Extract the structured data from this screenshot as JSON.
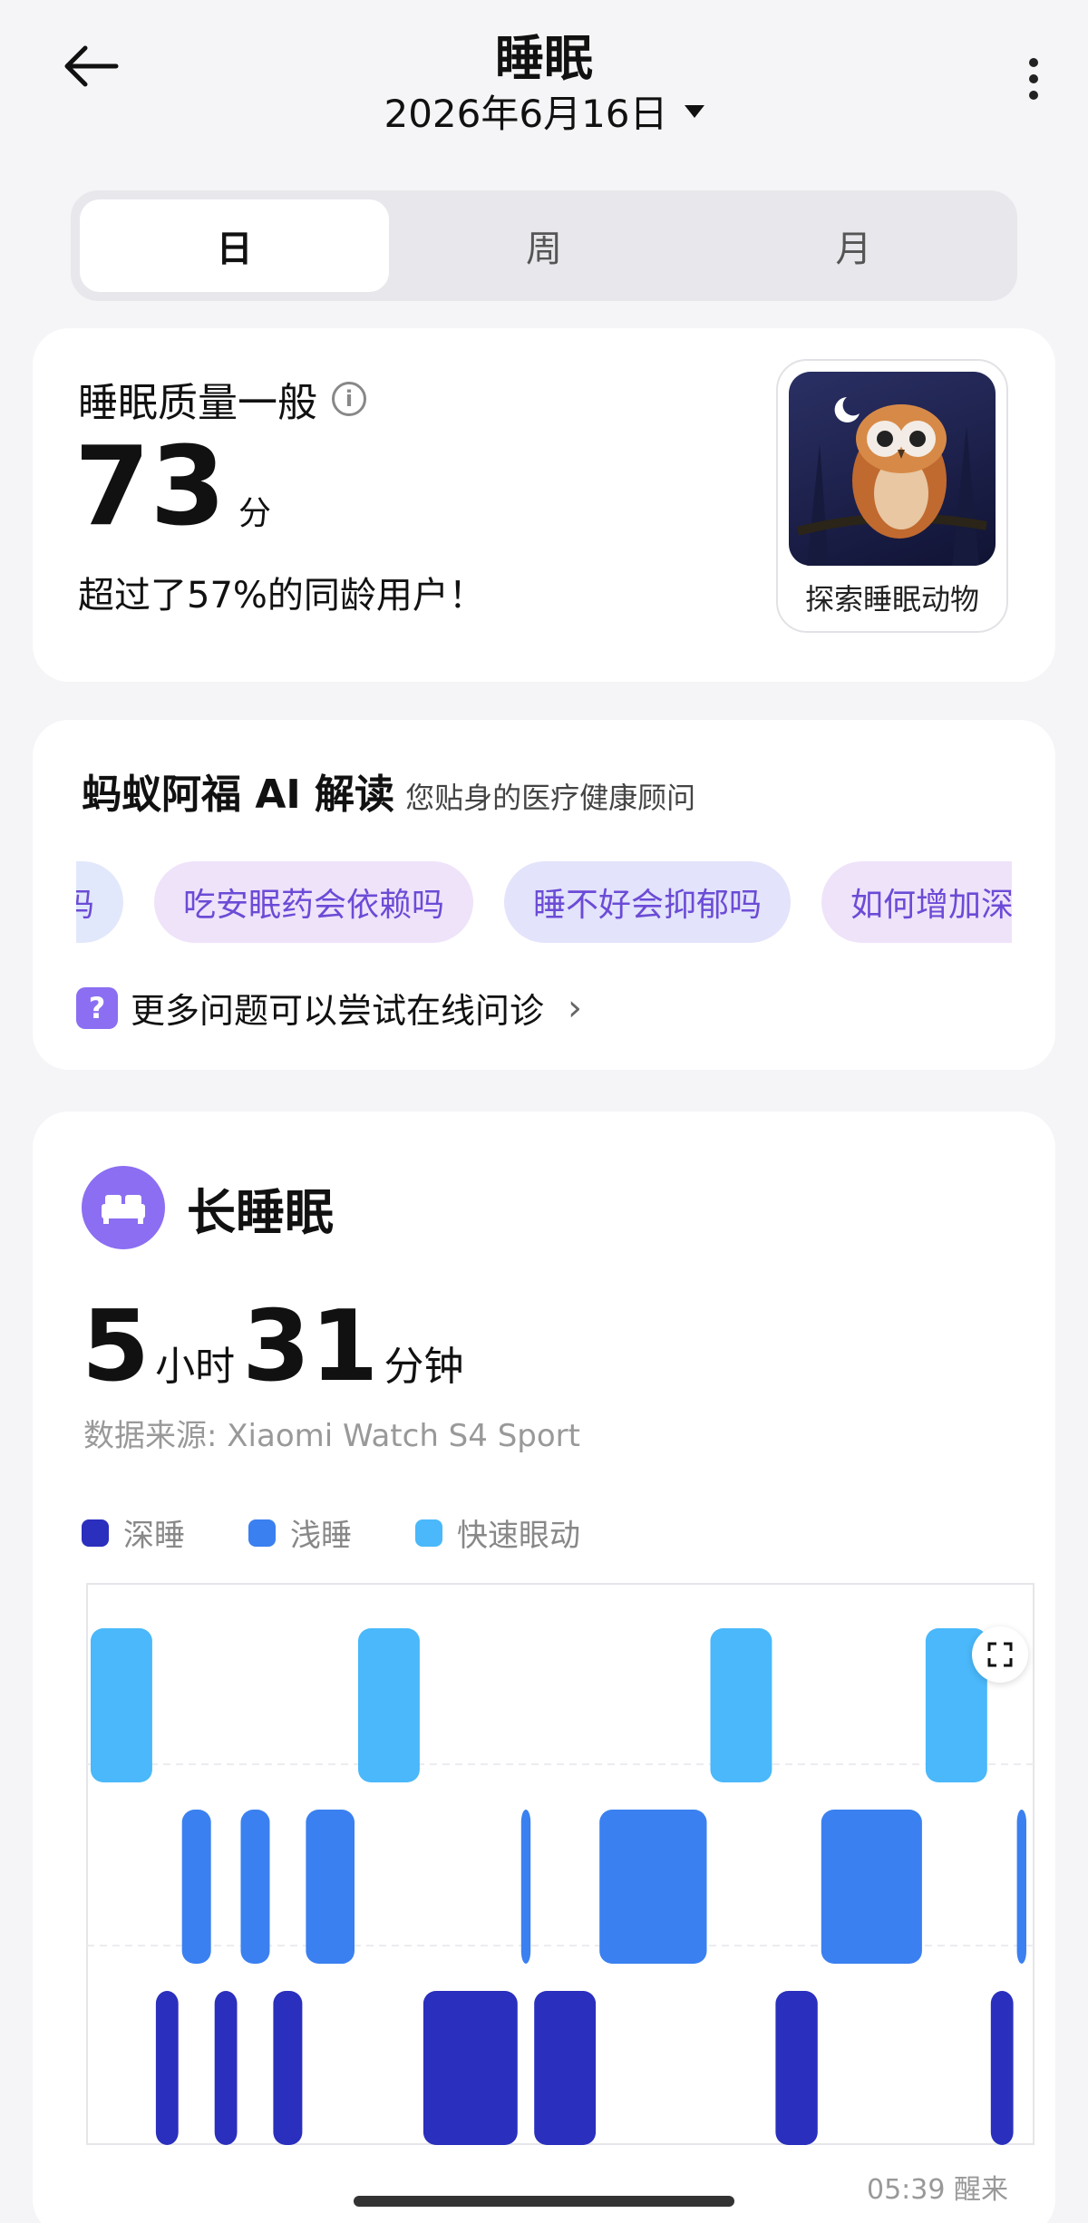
{
  "header": {
    "title": "睡眠",
    "date": "2026年6月16日"
  },
  "tabs": [
    {
      "label": "日",
      "active": true
    },
    {
      "label": "周",
      "active": false
    },
    {
      "label": "月",
      "active": false
    }
  ],
  "score": {
    "quality_label": "睡眠质量一般",
    "score_value": "73",
    "score_unit": "分",
    "exceed_text": "超过了57%的同龄用户！",
    "animal_label": "探索睡眠动物"
  },
  "ai": {
    "title": "蚂蚁阿福 AI 解读",
    "subtitle": "您贴身的医疗健康顾问",
    "chips": [
      "正常吗",
      "吃安眠药会依赖吗",
      "睡不好会抑郁吗",
      "如何增加深睡"
    ],
    "more_questions": "更多问题可以尝试在线问诊"
  },
  "sleep": {
    "label": "长睡眠",
    "hours": "5",
    "hours_unit": "小时",
    "minutes": "31",
    "minutes_unit": "分钟",
    "source": "数据来源: Xiaomi Watch S4 Sport",
    "wake_text": "05:39 醒来"
  },
  "colors": {
    "deep": "#2a2fbd",
    "light": "#3a80f0",
    "rem": "#4ab8fa",
    "accent": "#8b6ef2"
  },
  "chart_data": {
    "type": "area",
    "legend": [
      {
        "name": "深睡",
        "color": "#2a2fbd"
      },
      {
        "name": "浅睡",
        "color": "#3a80f0"
      },
      {
        "name": "快速眼动",
        "color": "#4ab8fa"
      }
    ],
    "stages_order": [
      "快速眼动",
      "浅睡",
      "深睡"
    ],
    "segments": [
      {
        "stage": "快速眼动",
        "duration": 10
      },
      {
        "stage": "深睡",
        "duration": 4
      },
      {
        "stage": "浅睡",
        "duration": 5
      },
      {
        "stage": "深睡",
        "duration": 4
      },
      {
        "stage": "浅睡",
        "duration": 5
      },
      {
        "stage": "深睡",
        "duration": 5
      },
      {
        "stage": "浅睡",
        "duration": 8
      },
      {
        "stage": "快速眼动",
        "duration": 10
      },
      {
        "stage": "深睡",
        "duration": 15
      },
      {
        "stage": "浅睡",
        "duration": 2
      },
      {
        "stage": "深睡",
        "duration": 10
      },
      {
        "stage": "浅睡",
        "duration": 17
      },
      {
        "stage": "快速眼动",
        "duration": 10
      },
      {
        "stage": "深睡",
        "duration": 7
      },
      {
        "stage": "浅睡",
        "duration": 16
      },
      {
        "stage": "快速眼动",
        "duration": 10
      },
      {
        "stage": "深睡",
        "duration": 4
      },
      {
        "stage": "浅睡",
        "duration": 2
      }
    ],
    "end_label": "05:39 醒来"
  }
}
